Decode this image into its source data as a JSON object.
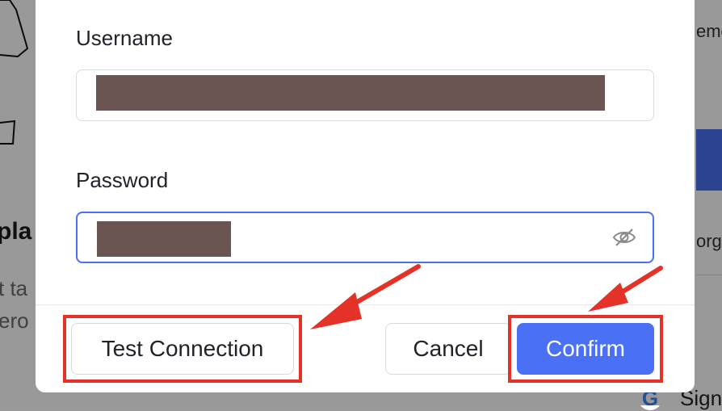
{
  "background": {
    "left_heading": "pla",
    "left_lines": [
      "t ta",
      "ero"
    ],
    "right_lines": [
      "eme",
      "orge"
    ],
    "google_signin_text": "Sign"
  },
  "dialog": {
    "username": {
      "label": "Username",
      "value": ""
    },
    "password": {
      "label": "Password",
      "value": "",
      "toggle_icon": "eye-slash-icon"
    },
    "buttons": {
      "test_connection": "Test Connection",
      "cancel": "Cancel",
      "confirm": "Confirm"
    }
  },
  "colors": {
    "primary": "#4a70f5",
    "focus_border": "#4c6ef5",
    "annotation_red": "#e53229",
    "redaction": "#6b5552"
  }
}
